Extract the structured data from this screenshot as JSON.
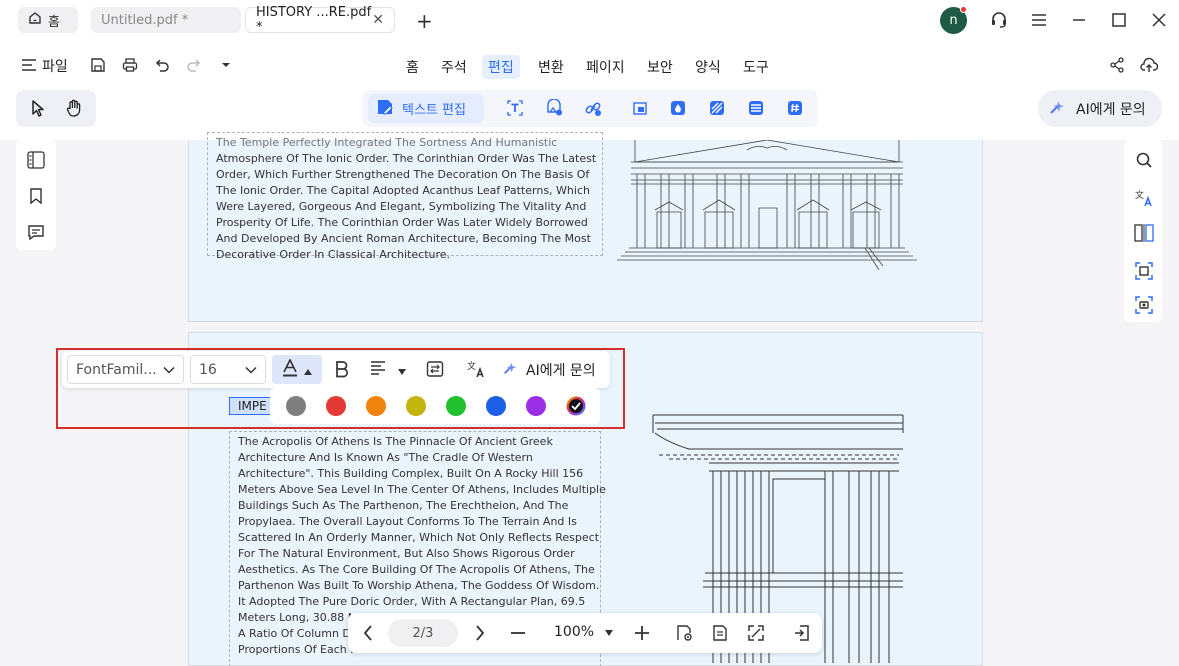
{
  "tabs": {
    "home_label": "홈",
    "untitled_label": "Untitled.pdf *",
    "history_label": "HISTORY ...RE.pdf *",
    "close_glyph": "✕",
    "add_glyph": "+"
  },
  "user": {
    "avatar_letter": "n"
  },
  "menubar": {
    "file_label": "파일",
    "menus": [
      "홈",
      "주석",
      "편집",
      "변환",
      "페이지",
      "보안",
      "양식",
      "도구"
    ],
    "active_menu": "편집"
  },
  "toolbar": {
    "text_edit_label": "텍스트 편집",
    "ai_label": "AI에게 문의"
  },
  "document": {
    "block1_lines": [
      "The Temple Perfectly Integrated The Sortness And Humanistic",
      "Atmosphere Of The Ionic Order. The Corinthian Order Was The Latest",
      "Order, Which Further Strengthened The Decoration On The Basis Of",
      "The Ionic Order. The Capital Adopted Acanthus Leaf Patterns, Which",
      "Were Layered, Gorgeous And Elegant, Symbolizing The Vitality And",
      "Prosperity Of Life. The Corinthian Order Was Later Widely Borrowed",
      "And Developed By Ancient Roman Architecture, Becoming The Most",
      "Decorative Order In Classical Architecture."
    ],
    "block2_lines": [
      "The Acropolis Of Athens Is The Pinnacle Of Ancient Greek",
      "Architecture And Is Known As \"The Cradle Of Western",
      "Architecture\". This Building Complex, Built On A Rocky Hill 156",
      "Meters Above Sea Level In The Center Of Athens, Includes Multiple",
      "Buildings Such As The Parthenon, The Erechtheion, And The",
      "Propylaea. The Overall Layout Conforms To The Terrain And Is",
      "Scattered In An Orderly Manner, Which Not Only Reflects Respect",
      "For The Natural Environment, But Also Shows Rigorous Order",
      "Aesthetics. As The Core Building Of The Acropolis Of Athens, The",
      "Parthenon Was Built To Worship Athena, The Goddess Of Wisdom.",
      "It Adopted The Pure Doric Order, With A Rectangular Plan, 69.5",
      "Meters Long, 30.88 Meters Wide, 10.43 Meters High Columns, And",
      "A Ratio Of Column Diameter...",
      "Proportions Of Each P..."
    ],
    "selected_text": "IMPE"
  },
  "format_bar": {
    "font_family": "FontFamil...",
    "font_size": "16",
    "ai_label": "AI에게 문의",
    "swatches": [
      "#7f7f7f",
      "#e53935",
      "#f0830e",
      "#c2b40a",
      "#22c02e",
      "#1f5fe8",
      "#9b2fe8",
      "#111111"
    ]
  },
  "bottom_nav": {
    "page_indicator": "2/3",
    "zoom": "100%"
  }
}
